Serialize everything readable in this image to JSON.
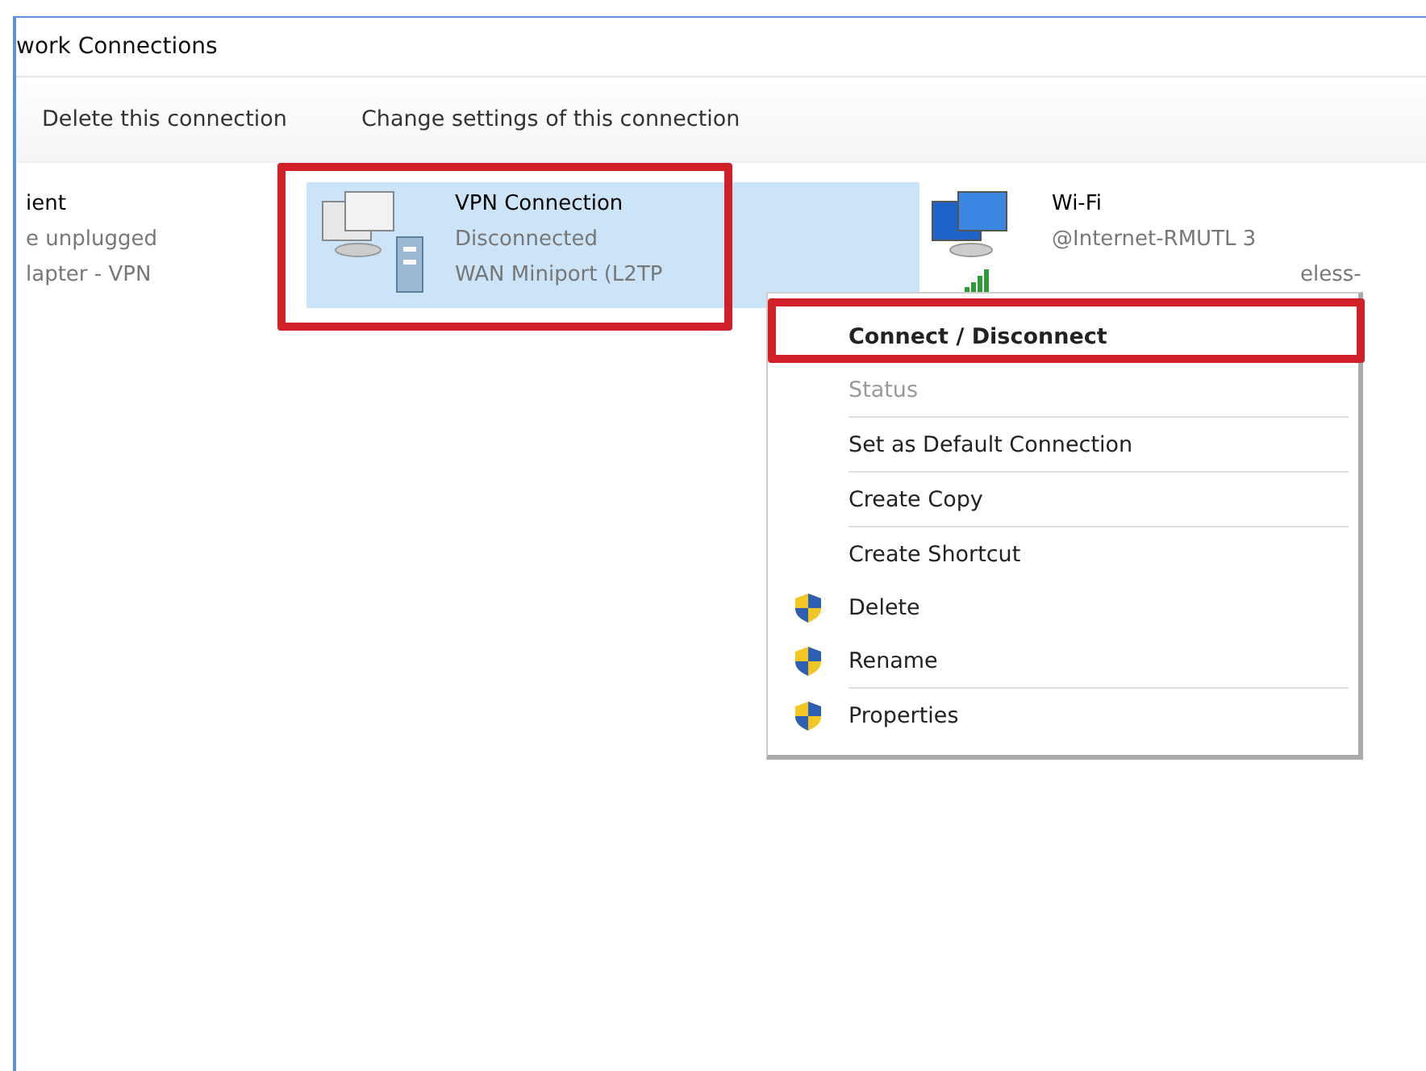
{
  "window": {
    "title": "work Connections"
  },
  "toolbar": [
    "Delete this connection",
    "Change settings of this connection"
  ],
  "connections": [
    {
      "kind": "ethernet",
      "name": "ient",
      "status": "e unplugged",
      "device": "lapter - VPN",
      "selected": false,
      "highlighted": false
    },
    {
      "kind": "vpn",
      "name": "VPN Connection",
      "status": "Disconnected",
      "device": "WAN Miniport (L2TP",
      "selected": true,
      "highlighted": true
    },
    {
      "kind": "wifi",
      "name": "Wi-Fi",
      "status": "@Internet-RMUTL  3",
      "device": "eless-",
      "selected": false,
      "highlighted": false
    }
  ],
  "context_menu": {
    "items": [
      {
        "label": "Connect / Disconnect",
        "default": true,
        "disabled": false,
        "shield": false,
        "separator_after": false,
        "highlighted": true
      },
      {
        "label": "Status",
        "default": false,
        "disabled": true,
        "shield": false,
        "separator_after": true,
        "highlighted": false
      },
      {
        "label": "Set as Default Connection",
        "default": false,
        "disabled": false,
        "shield": false,
        "separator_after": true,
        "highlighted": false
      },
      {
        "label": "Create Copy",
        "default": false,
        "disabled": false,
        "shield": false,
        "separator_after": true,
        "highlighted": false
      },
      {
        "label": "Create Shortcut",
        "default": false,
        "disabled": false,
        "shield": false,
        "separator_after": false,
        "highlighted": false
      },
      {
        "label": "Delete",
        "default": false,
        "disabled": false,
        "shield": true,
        "separator_after": false,
        "highlighted": false
      },
      {
        "label": "Rename",
        "default": false,
        "disabled": false,
        "shield": true,
        "separator_after": true,
        "highlighted": false
      },
      {
        "label": "Properties",
        "default": false,
        "disabled": false,
        "shield": true,
        "separator_after": false,
        "highlighted": false
      }
    ]
  }
}
